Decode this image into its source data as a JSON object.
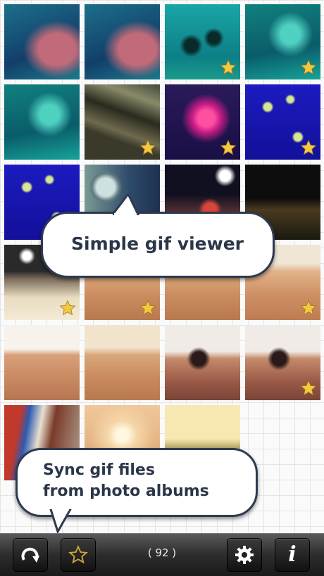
{
  "colors": {
    "star": "#f5c842",
    "bubble_text": "#2b3648",
    "toolbar": "#2d2d2d"
  },
  "tiles": [
    {
      "row": 0,
      "col": 0,
      "scene": "aquarium-pink",
      "starred": false
    },
    {
      "row": 0,
      "col": 1,
      "scene": "aquarium-pink",
      "starred": false
    },
    {
      "row": 0,
      "col": 2,
      "scene": "aquarium-divers",
      "starred": true
    },
    {
      "row": 0,
      "col": 3,
      "scene": "aquarium-teal",
      "starred": true
    },
    {
      "row": 1,
      "col": 0,
      "scene": "aquarium-teal",
      "starred": false
    },
    {
      "row": 1,
      "col": 1,
      "scene": "wood-hut",
      "starred": true
    },
    {
      "row": 1,
      "col": 2,
      "scene": "jellyfish-magenta",
      "starred": true
    },
    {
      "row": 1,
      "col": 3,
      "scene": "jellyfish-blue",
      "starred": true
    },
    {
      "row": 2,
      "col": 0,
      "scene": "jellyfish-blue",
      "starred": false
    },
    {
      "row": 2,
      "col": 1,
      "scene": "ship-porthole",
      "starred": false
    },
    {
      "row": 2,
      "col": 2,
      "scene": "night-dancer",
      "starred": false
    },
    {
      "row": 2,
      "col": 3,
      "scene": "night-camp",
      "starred": false
    },
    {
      "row": 3,
      "col": 0,
      "scene": "desert-dusk",
      "starred": true
    },
    {
      "row": 3,
      "col": 1,
      "scene": "desert-sand",
      "starred": true
    },
    {
      "row": 3,
      "col": 2,
      "scene": "desert-sand",
      "starred": false
    },
    {
      "row": 3,
      "col": 3,
      "scene": "desert-dune",
      "starred": true
    },
    {
      "row": 4,
      "col": 0,
      "scene": "desert-people",
      "starred": false
    },
    {
      "row": 4,
      "col": 1,
      "scene": "desert-sand",
      "starred": false
    },
    {
      "row": 4,
      "col": 2,
      "scene": "camel-ride",
      "starred": false
    },
    {
      "row": 4,
      "col": 3,
      "scene": "camel-ride",
      "starred": true
    },
    {
      "row": 5,
      "col": 0,
      "scene": "crowd",
      "starred": false
    },
    {
      "row": 5,
      "col": 1,
      "scene": "desert-sunset",
      "starred": false
    },
    {
      "row": 5,
      "col": 2,
      "scene": "desert-horizon",
      "starred": false
    }
  ],
  "callouts": {
    "viewer": "Simple gif viewer",
    "sync": "Sync gif files\nfrom photo albums"
  },
  "toolbar": {
    "count": "( 92 )",
    "sync_icon": "sync-arrow-icon",
    "favorites_icon": "star-outline-icon",
    "settings_icon": "gear-icon",
    "info_icon": "info-icon"
  }
}
